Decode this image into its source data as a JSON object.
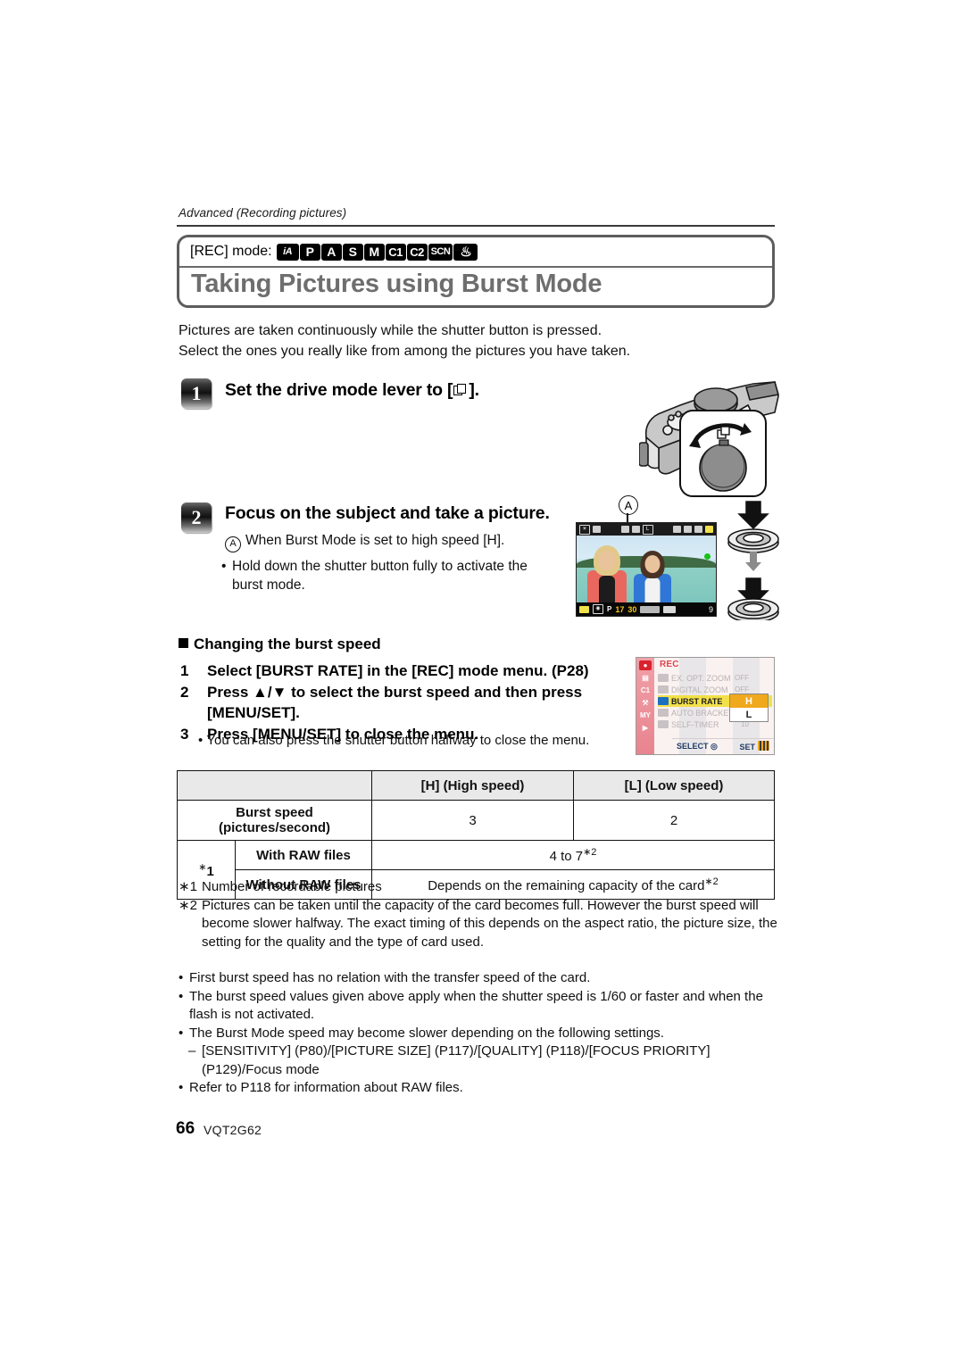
{
  "header": {
    "running_head": "Advanced (Recording pictures)"
  },
  "title_block": {
    "mode_label": "[REC] mode:",
    "mode_icons": [
      "iA",
      "P",
      "A",
      "S",
      "M",
      "C1",
      "C2",
      "SCN",
      "custom"
    ],
    "title": "Taking Pictures using Burst Mode"
  },
  "intro": {
    "line1": "Pictures are taken continuously while the shutter button is pressed.",
    "line2": "Select the ones you really like from among the pictures you have taken."
  },
  "steps": {
    "step1": {
      "number": "1",
      "heading_before": "Set the drive mode lever to [",
      "heading_after": "].",
      "icon_name": "burst-drive-mode-icon"
    },
    "step2": {
      "number": "2",
      "heading": "Focus on the subject and take a picture.",
      "callout_letter": "A",
      "callout_text": "When Burst Mode is set to high speed [H].",
      "bullet": "Hold down the shutter button fully to activate the burst mode."
    }
  },
  "lcd_preview": {
    "callout_letter": "A",
    "mode_indicator": "P",
    "shutter_value": "17",
    "aperture_value": "30",
    "remaining_shots": "9"
  },
  "burst_section": {
    "heading": "Changing the burst speed",
    "steps": [
      {
        "num": "1",
        "text": "Select [BURST RATE] in the [REC] mode menu. (P28)"
      },
      {
        "num": "2",
        "text": "Press ▲/▼ to select the burst speed and then press [MENU/SET]."
      },
      {
        "num": "3",
        "text": "Press [MENU/SET] to close the menu."
      }
    ],
    "note": "You can also press the shutter button halfway to close the menu."
  },
  "menu_screenshot": {
    "title": "REC",
    "items": [
      {
        "label": "EX. OPT. ZOOM",
        "value": "OFF",
        "selected": false
      },
      {
        "label": "DIGITAL ZOOM",
        "value": "OFF",
        "selected": false
      },
      {
        "label": "BURST RATE",
        "value": "",
        "selected": true
      },
      {
        "label": "AUTO BRACKET",
        "value": "",
        "selected": false
      },
      {
        "label": "SELF-TIMER",
        "value": "10",
        "selected": false
      }
    ],
    "popup_options": [
      {
        "label": "H",
        "active": true
      },
      {
        "label": "L",
        "active": false
      }
    ],
    "footer_left": "SELECT",
    "footer_right": "SET",
    "accent_red": "#e0444f",
    "accent_yellow": "#f2e04a",
    "accent_orange": "#f0a81d"
  },
  "spec_table": {
    "col_headers": [
      "",
      "[H] (High speed)",
      "[L] (Low speed)"
    ],
    "rows": [
      {
        "label": "Burst speed (pictures/second)",
        "high": "3",
        "low": "2"
      },
      {
        "group": "∗1",
        "label": "With RAW files",
        "span_value": "4 to 7",
        "span_sup": "∗2"
      },
      {
        "group": "",
        "label": "Without RAW files",
        "span_value": "Depends on the remaining capacity of the card",
        "span_sup": "∗2"
      }
    ]
  },
  "footnotes": [
    {
      "mark": "∗1",
      "text": "Number of recordable pictures"
    },
    {
      "mark": "∗2",
      "text": "Pictures can be taken until the capacity of the card becomes full. However the burst speed will become slower halfway. The exact timing of this depends on the aspect ratio, the picture size, the setting for the quality and the type of card used."
    }
  ],
  "bullets": [
    "First burst speed has no relation with the transfer speed of the card.",
    "The burst speed values given above apply when the shutter speed is 1/60 or faster and when the flash is not activated.",
    "The Burst Mode speed may become slower depending on the following settings.",
    "Refer to P118 for information about RAW files."
  ],
  "bullet_sub": "[SENSITIVITY] (P80)/[PICTURE SIZE] (P117)/[QUALITY] (P118)/[FOCUS PRIORITY] (P129)/Focus mode",
  "footer": {
    "page_number": "66",
    "doc_code": "VQT2G62"
  }
}
